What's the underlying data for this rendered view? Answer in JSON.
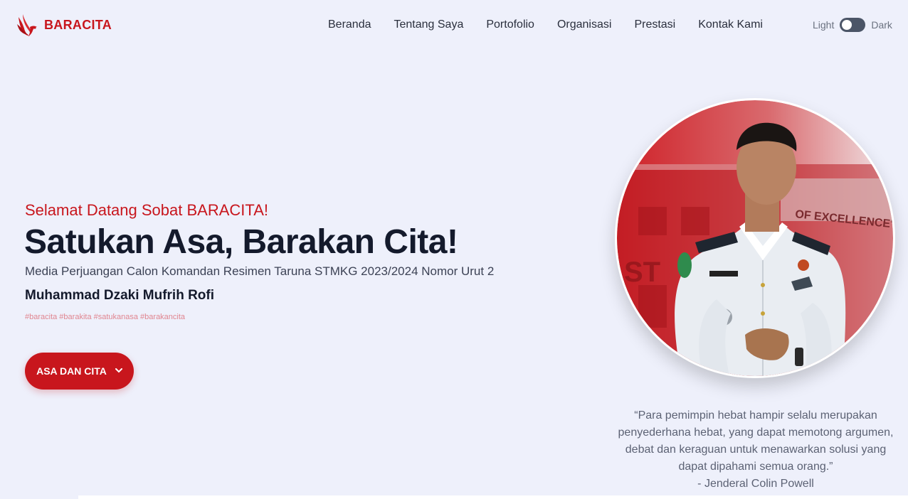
{
  "brand": {
    "name": "BARACITA",
    "logo_icon": "phoenix-bird-icon",
    "color": "#c8161d"
  },
  "nav": {
    "items": [
      {
        "label": "Beranda"
      },
      {
        "label": "Tentang Saya"
      },
      {
        "label": "Portofolio"
      },
      {
        "label": "Organisasi"
      },
      {
        "label": "Prestasi"
      },
      {
        "label": "Kontak Kami"
      }
    ],
    "theme": {
      "light_label": "Light",
      "dark_label": "Dark",
      "dark_mode": false
    }
  },
  "hero": {
    "welcome": "Selamat Datang Sobat BARACITA!",
    "headline": "Satukan Asa, Barakan Cita!",
    "subline": "Media Perjuangan Calon Komandan Resimen Taruna STMKG 2023/2024 Nomor Urut 2",
    "person_name": "Muhammad Dzaki Mufrih Rofi",
    "hashtags": "#baracita #barakita #satukanasa #barakancita",
    "cta_label": "ASA DAN CITA",
    "cta_icon": "chevron-down-icon"
  },
  "photo": {
    "building_sign": "OF EXCELLENCE\"",
    "building_letters": "ST"
  },
  "quote": {
    "text": "“Para pemimpin hebat hampir selalu merupakan penyederhana hebat, yang dapat memotong argumen, debat dan keraguan untuk menawarkan solusi yang dapat dipahami semua orang.”",
    "author": "- Jenderal Colin Powell"
  },
  "colors": {
    "accent": "#c8161d",
    "background": "#eef0fb",
    "heading": "#141a2c"
  }
}
